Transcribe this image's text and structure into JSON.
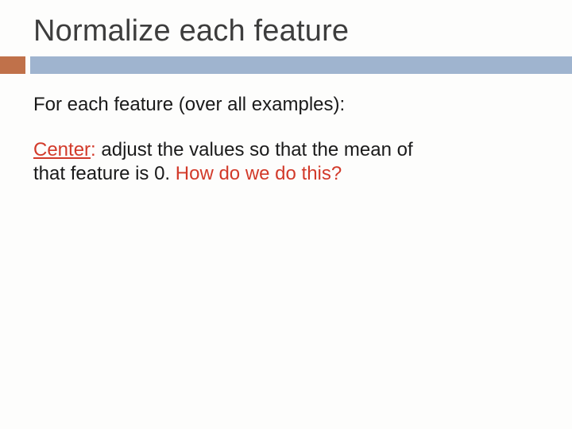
{
  "title": "Normalize each feature",
  "intro": "For each feature (over all examples):",
  "center": {
    "label": "Center",
    "colon": ":",
    "body_1": "  adjust the values so that the mean of",
    "body_2": "that feature is 0.  ",
    "question": "How do we do this?"
  }
}
